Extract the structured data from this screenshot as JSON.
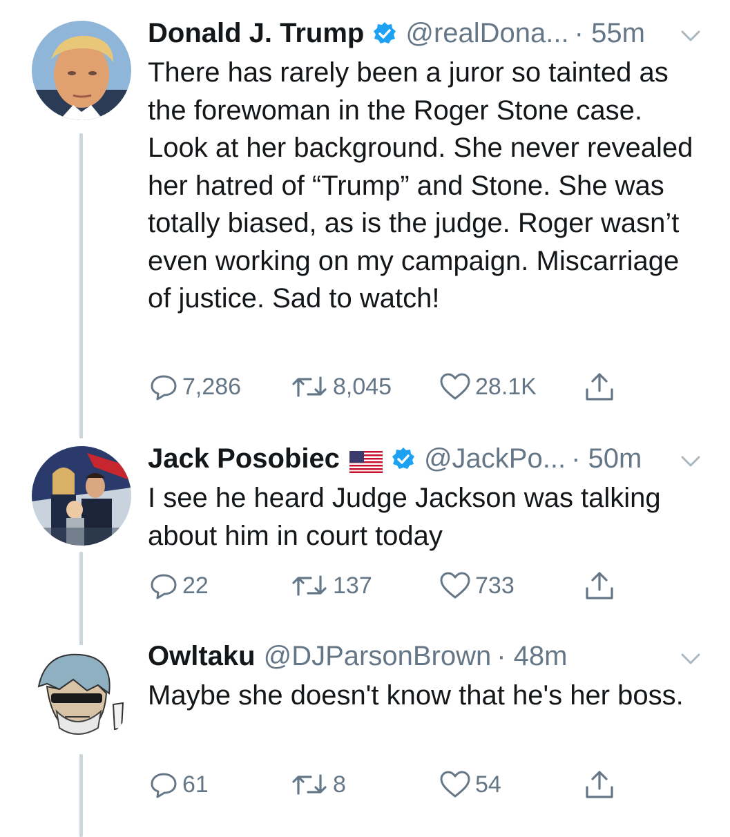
{
  "tweets": [
    {
      "name": "Donald J. Trump",
      "handle": "@realDona...",
      "time": "· 55m",
      "text": "There has rarely been a juror so tainted as the forewoman in the Roger Stone case. Look at her background. She never revealed her hatred of “Trump” and Stone. She was totally biased, as is the judge. Roger wasn’t even working on my campaign. Miscarriage of justice. Sad to watch!",
      "replies": "7,286",
      "retweets": "8,045",
      "likes": "28.1K"
    },
    {
      "name": "Jack Posobiec",
      "handle": "@JackPo...",
      "time": "· 50m",
      "text": "I see he heard Judge Jackson was talking about him in court today",
      "replies": "22",
      "retweets": "137",
      "likes": "733"
    },
    {
      "name": "Owltaku",
      "handle": "@DJParsonBrown",
      "time": "· 48m",
      "text": "Maybe she doesn't know that he's her boss.",
      "replies": "61",
      "retweets": "8",
      "likes": "54"
    }
  ],
  "icons": {
    "reply": "reply-icon",
    "retweet": "retweet-icon",
    "like": "heart-icon",
    "share": "share-icon",
    "verified": "verified-badge-icon",
    "flag": "us-flag-icon",
    "chevron": "chevron-down-icon"
  },
  "colors": {
    "text": "#14171a",
    "muted": "#657786",
    "verified": "#1da1f2",
    "thread": "#ccd6dd"
  }
}
